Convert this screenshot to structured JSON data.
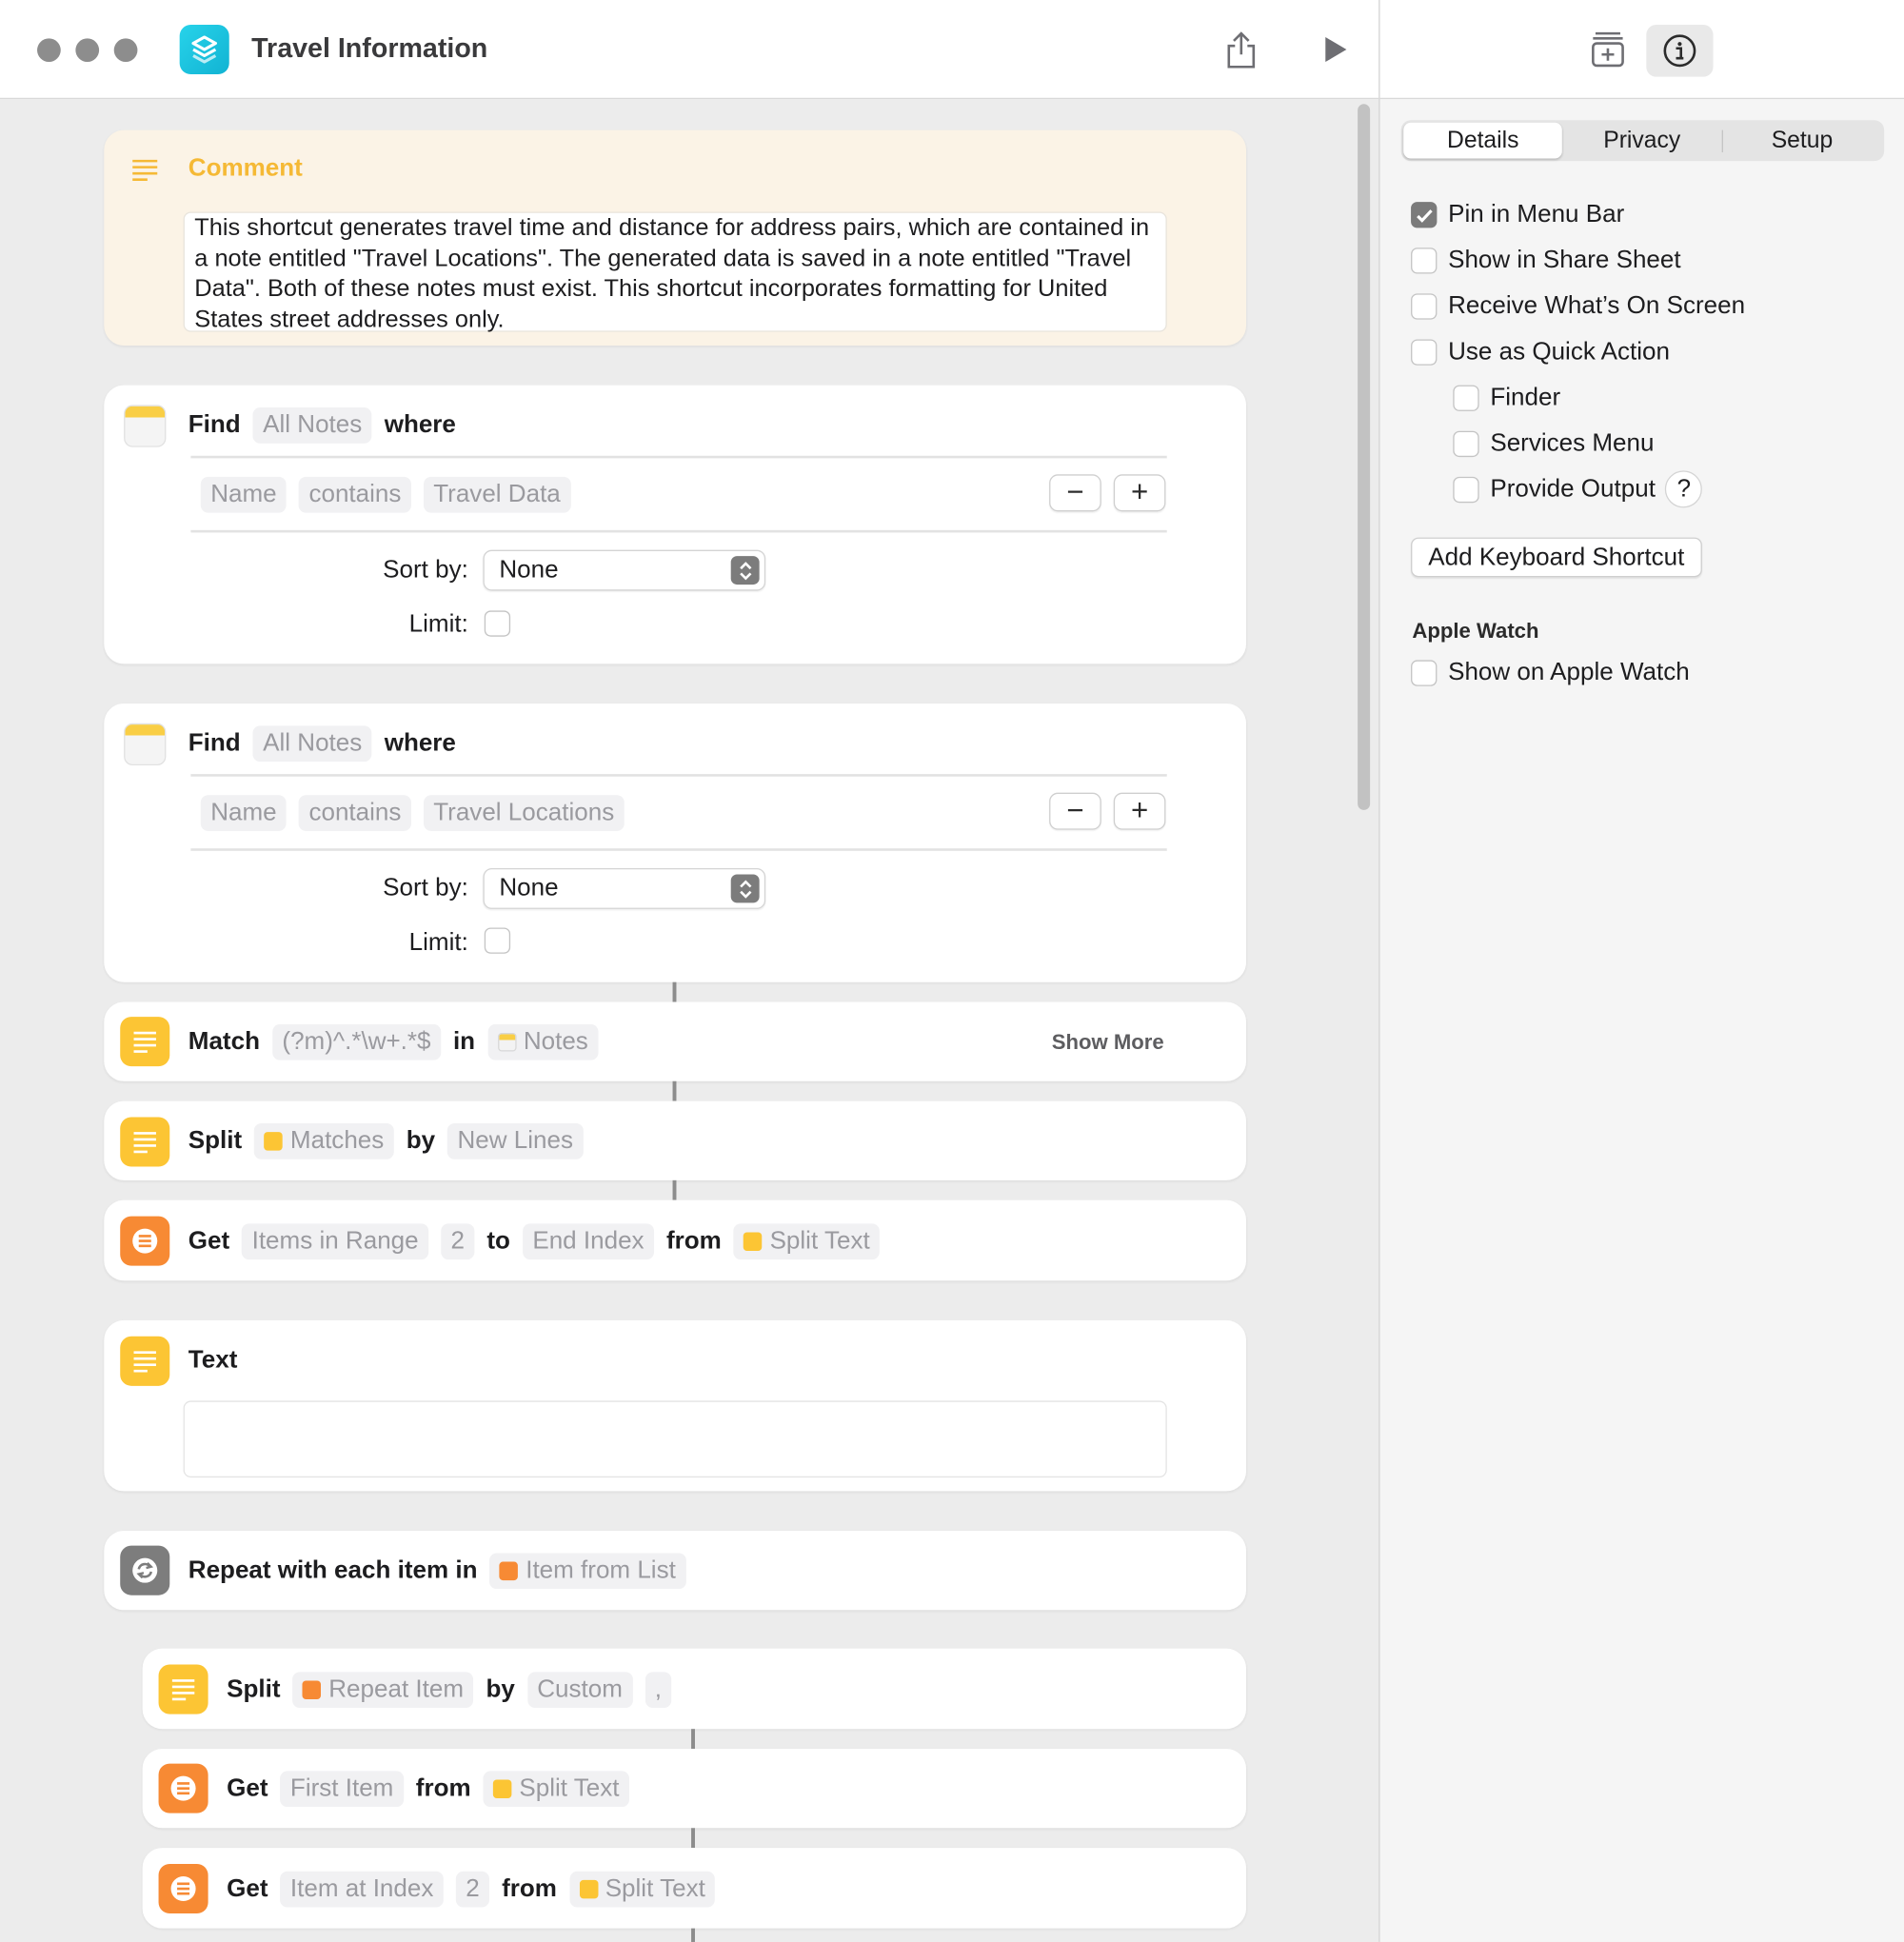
{
  "window": {
    "title": "Travel Information",
    "icons": {
      "app": "shortcuts-app-icon",
      "share": "share-icon",
      "run": "play-icon",
      "library": "action-library-icon",
      "info": "info-icon"
    }
  },
  "comment": {
    "title": "Comment",
    "text": "This shortcut generates travel time and distance for address pairs, which are contained in a note entitled \"Travel Locations\". The generated data is saved in a note entitled \"Travel Data\". Both of these notes must exist. This shortcut incorporates formatting for United States street addresses only."
  },
  "find1": {
    "verb": "Find",
    "source": "All Notes",
    "where": "where",
    "field": "Name",
    "op": "contains",
    "value": "Travel Data",
    "sort_label": "Sort by:",
    "sort_value": "None",
    "limit_label": "Limit:",
    "minus": "−",
    "plus": "+"
  },
  "find2": {
    "verb": "Find",
    "source": "All Notes",
    "where": "where",
    "field": "Name",
    "op": "contains",
    "value": "Travel Locations",
    "sort_label": "Sort by:",
    "sort_value": "None",
    "limit_label": "Limit:",
    "minus": "−",
    "plus": "+"
  },
  "match": {
    "verb": "Match",
    "pattern": "(?m)^.*\\w+.*$",
    "in": "in",
    "input": "Notes",
    "show_more": "Show More"
  },
  "split1": {
    "verb": "Split",
    "input": "Matches",
    "by": "by",
    "separator": "New Lines"
  },
  "get_range": {
    "verb": "Get",
    "mode": "Items in Range",
    "start": "2",
    "to": "to",
    "end": "End Index",
    "from": "from",
    "input": "Split Text"
  },
  "text_action": {
    "verb": "Text",
    "content": ""
  },
  "repeat": {
    "verb": "Repeat with each item in",
    "input": "Item from List"
  },
  "split2": {
    "verb": "Split",
    "input": "Repeat Item",
    "by": "by",
    "separator": "Custom",
    "custom_value": ","
  },
  "get_first": {
    "verb": "Get",
    "mode": "First Item",
    "from": "from",
    "input": "Split Text"
  },
  "get_index": {
    "verb": "Get",
    "mode": "Item at Index",
    "index": "2",
    "from": "from",
    "input": "Split Text"
  },
  "sidebar": {
    "tabs": [
      "Details",
      "Privacy",
      "Setup"
    ],
    "active_tab": "Details",
    "options": [
      {
        "label": "Pin in Menu Bar",
        "checked": true
      },
      {
        "label": "Show in Share Sheet",
        "checked": false
      },
      {
        "label": "Receive What’s On Screen",
        "checked": false
      },
      {
        "label": "Use as Quick Action",
        "checked": false
      },
      {
        "label": "Finder",
        "checked": false
      },
      {
        "label": "Services Menu",
        "checked": false
      },
      {
        "label": "Provide Output",
        "checked": false
      }
    ],
    "help": "?",
    "keyboard_button": "Add Keyboard Shortcut",
    "watch_heading": "Apple Watch",
    "watch_option": {
      "label": "Show on Apple Watch",
      "checked": false
    }
  },
  "colors": {
    "accent_yellow": "#fcc534",
    "accent_orange": "#f78a34",
    "comment_bg": "#fbf3e6",
    "comment_title": "#f5b935",
    "app_icon": "#1fc3e0"
  }
}
